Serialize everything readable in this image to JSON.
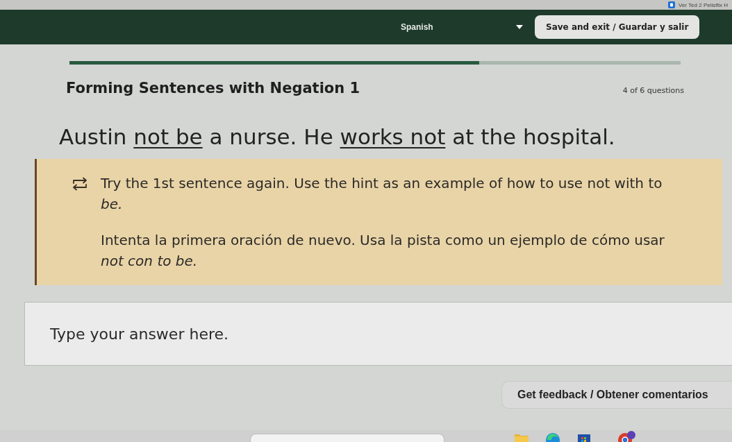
{
  "browser_tabs": [
    {
      "title": "Ver Ted 2 Pelisflix H"
    }
  ],
  "header": {
    "language": "Spanish",
    "save_button": "Save and exit / Guardar y salir"
  },
  "progress": {
    "level": 0.67,
    "counter": "4 of 6 questions"
  },
  "lesson_title": "Forming Sentences with Negation 1",
  "sentence": [
    {
      "kind": "plain",
      "text": "Austin "
    },
    {
      "kind": "underlined",
      "text": "not be"
    },
    {
      "kind": "plain",
      "text": " a nurse. He "
    },
    {
      "kind": "underlined",
      "text": "works not"
    },
    {
      "kind": "plain",
      "text": " at the hospital."
    }
  ],
  "feedback": {
    "messages": [
      "Try the 1st sentence again. Use the hint as an example of how to use not with to *be.*",
      "Intenta la primera oración de nuevo. Usa la pista como un ejemplo de cómo usar *not con to be.*"
    ]
  },
  "answer_field": {
    "placeholder": "Type your answer here."
  },
  "feedback_button": "Get feedback / Obtener comentarios"
}
